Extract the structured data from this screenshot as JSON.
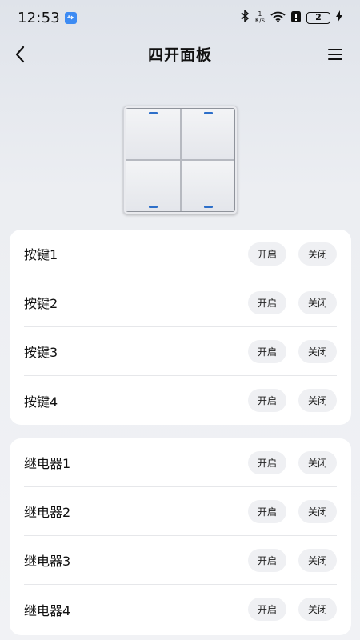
{
  "status_bar": {
    "time": "12:53",
    "net_speed_value": "1",
    "net_speed_unit": "K/s",
    "battery_level": "2"
  },
  "header": {
    "title": "四开面板",
    "back_icon": "chevron-left-icon",
    "menu_icon": "hamburger-menu-icon"
  },
  "panel": {
    "led_color": "#2d6fc9"
  },
  "keys": [
    {
      "label": "按键1",
      "on_label": "开启",
      "off_label": "关闭"
    },
    {
      "label": "按键2",
      "on_label": "开启",
      "off_label": "关闭"
    },
    {
      "label": "按键3",
      "on_label": "开启",
      "off_label": "关闭"
    },
    {
      "label": "按键4",
      "on_label": "开启",
      "off_label": "关闭"
    }
  ],
  "relays": [
    {
      "label": "继电器1",
      "on_label": "开启",
      "off_label": "关闭"
    },
    {
      "label": "继电器2",
      "on_label": "开启",
      "off_label": "关闭"
    },
    {
      "label": "继电器3",
      "on_label": "开启",
      "off_label": "关闭"
    },
    {
      "label": "继电器4",
      "on_label": "开启",
      "off_label": "关闭"
    }
  ]
}
